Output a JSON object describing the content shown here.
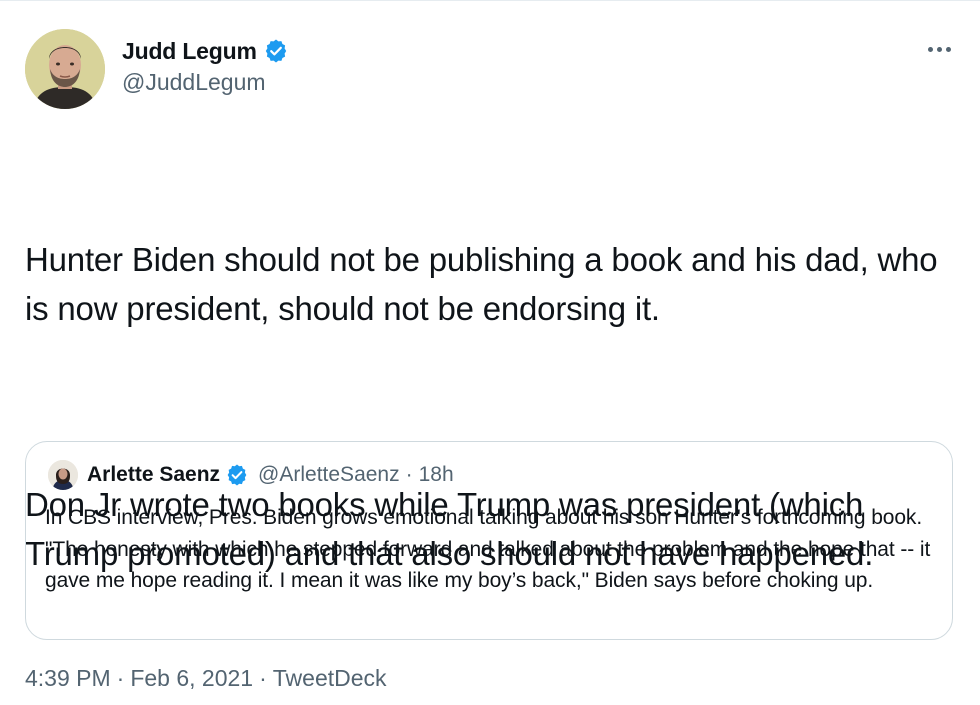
{
  "author": {
    "display_name": "Judd Legum",
    "handle": "@JuddLegum",
    "verified": true
  },
  "tweet": {
    "paragraphs": [
      "Hunter Biden should not be publishing a book and his dad, who is now president, should not be endorsing it.",
      "Don Jr wrote two books while Trump was president (which Trump promoted) and that also should not have happened."
    ]
  },
  "quoted_tweet": {
    "display_name": "Arlette Saenz",
    "handle": "@ArletteSaenz",
    "separator": "·",
    "time_ago": "18h",
    "verified": true,
    "text": "In CBS interview, Pres. Biden grows emotional talking about his son Hunter's forthcoming book. \"The honesty with which he stepped forward and talked about the problem and the hope that -- it gave me hope reading it. I mean it was like my boy’s back,\" Biden says before choking up."
  },
  "meta": {
    "time": "4:39 PM",
    "separator": "·",
    "date": "Feb 6, 2021",
    "source": "TweetDeck"
  },
  "icons": {
    "more": "more-horizontal-icon",
    "verified": "verified-badge-icon"
  },
  "colors": {
    "verified_blue": "#1d9bf0",
    "secondary_text": "#536471",
    "border": "#cfd9de"
  }
}
